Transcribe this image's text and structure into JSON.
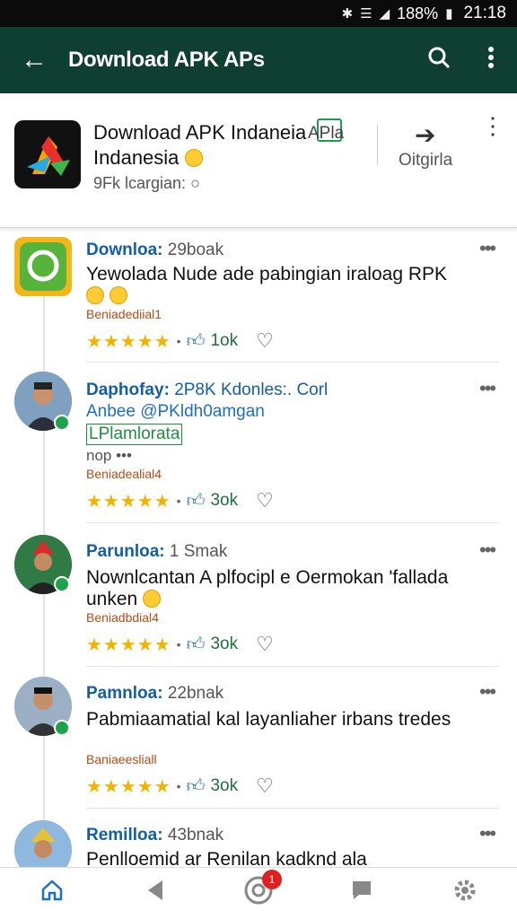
{
  "status_bar": {
    "time": "21:18",
    "battery": "188%"
  },
  "app_bar": {
    "title": "Download APK APs"
  },
  "header": {
    "title_line1": "Download APK Indaneia",
    "title_line2": "Indanesia",
    "subtitle": "9Fk lcargian:",
    "apla_label": "APla",
    "share_label": "Oitgirla"
  },
  "posts": [
    {
      "name": "Downloa:",
      "meta": "29boak",
      "text": "Yewolada Nude ade pabingian iraloag RPK",
      "tag": "Beniadediial1",
      "likes": "1ok"
    },
    {
      "name": "Daphofay:",
      "meta": "2P8K Kdonles:. Corl",
      "line2": "Anbee @PKldh0amgan",
      "line3": "LPlamlorata",
      "line4": "nop •••",
      "tag": "Beniadealial4",
      "likes": "3ok"
    },
    {
      "name": "Parunloa:",
      "meta": "1 Smak",
      "text": "Nownlcantan A plfocipl e Oermokan 'fallada unken",
      "tag": "Beniadbdial4",
      "likes": "3ok"
    },
    {
      "name": "Pamnloa:",
      "meta": "22bnak",
      "text": "Pabmiaamatial kal layanliaher irbans tredes",
      "tag": "Baniaeesliall",
      "likes": "3ok"
    },
    {
      "name": "Remilloa:",
      "meta": "43bnak",
      "text": "Penlloemid ar Renilan kadknd ala"
    }
  ],
  "rating": {
    "stars": "★★★★★"
  },
  "nav": {
    "notification_count": "1"
  },
  "colors": {
    "app_bar": "#0f3f31",
    "link": "#125ea8",
    "star": "#f0b400",
    "tag": "#b74b12"
  }
}
